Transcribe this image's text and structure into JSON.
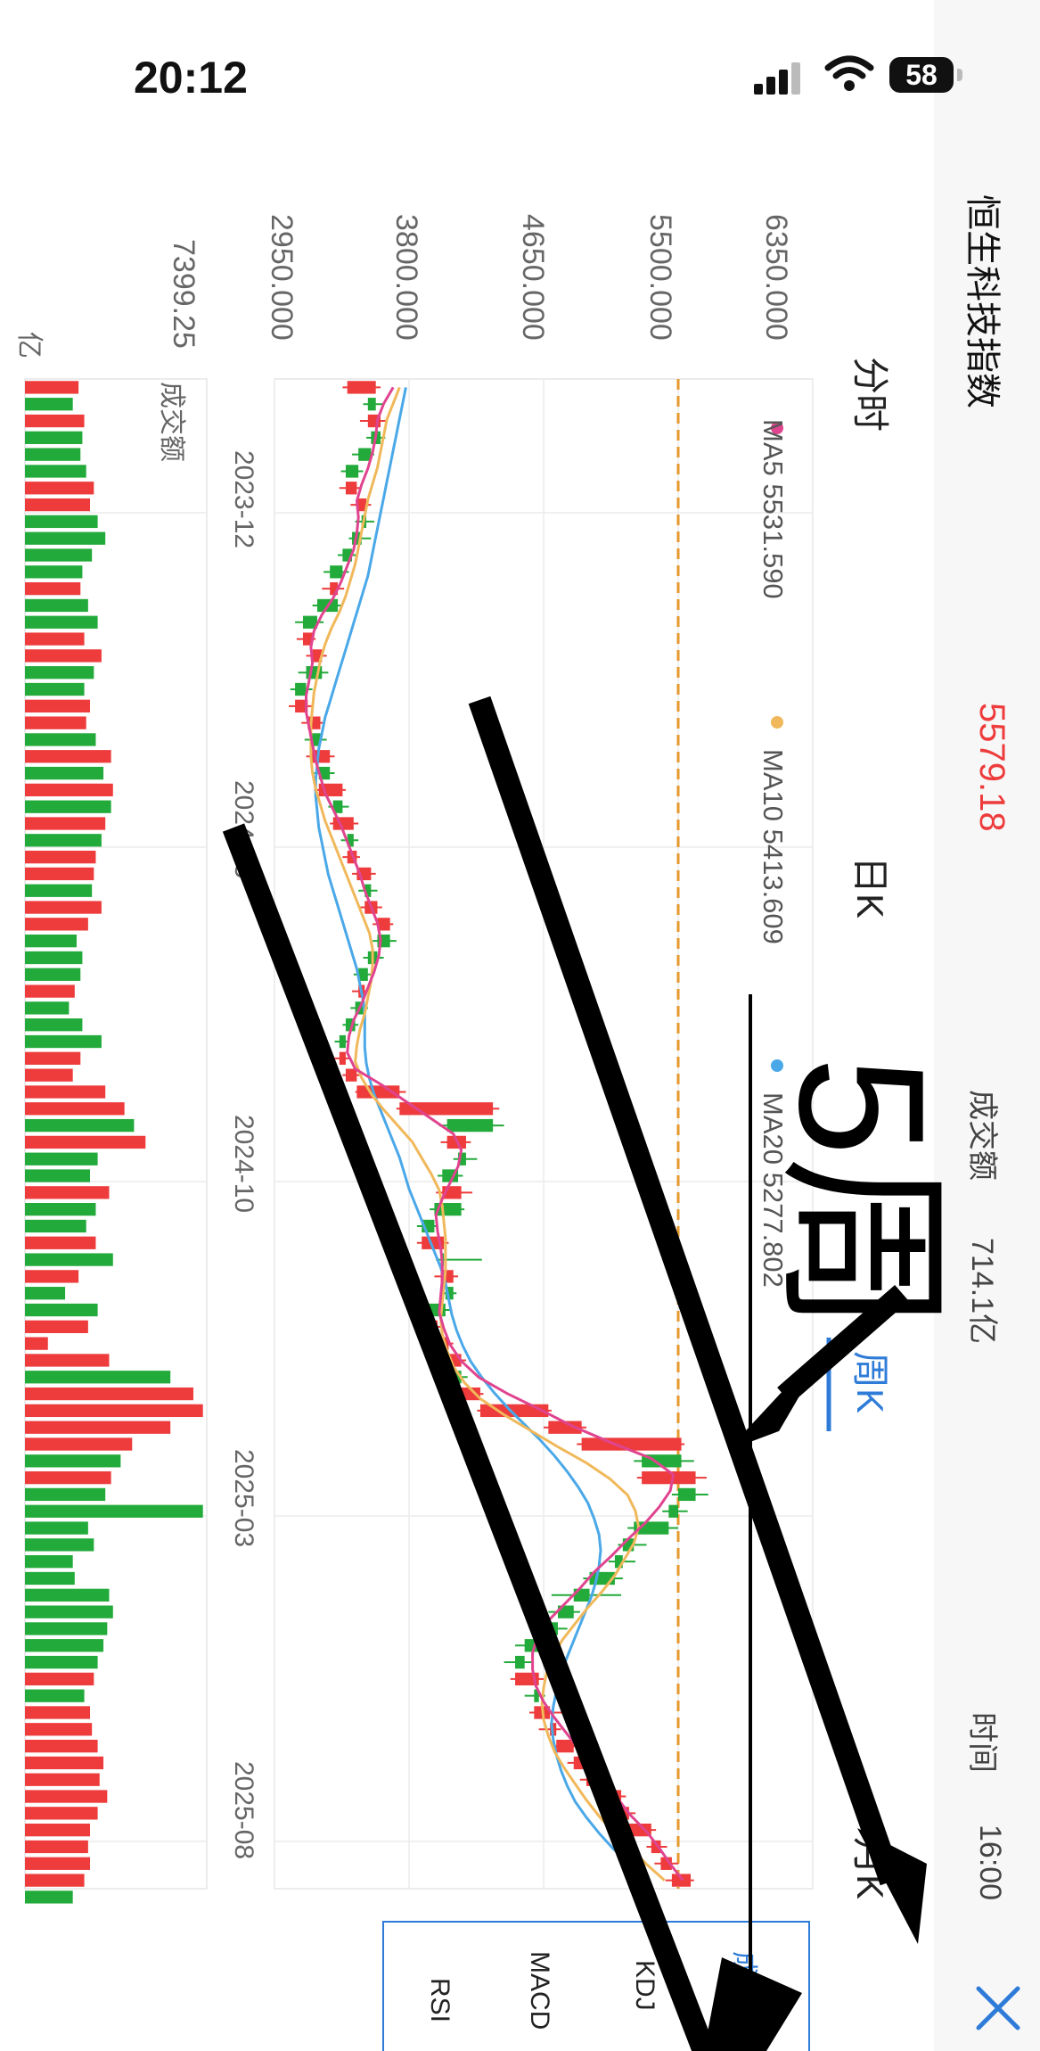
{
  "status_bar": {
    "time": "20:12",
    "battery": "58"
  },
  "header": {
    "title": "恒生科技指数",
    "price": "5579.18",
    "turnover_label": "成交额",
    "turnover_value": "714.1亿",
    "time_label": "时间",
    "time_value": "16:00",
    "close_icon": "close-icon"
  },
  "tabs": [
    {
      "label": "分时",
      "active": false
    },
    {
      "label": "日K",
      "active": false
    },
    {
      "label": "周K",
      "active": true
    },
    {
      "label": "月K",
      "active": false
    }
  ],
  "indicators": [
    {
      "label": "成交额",
      "active": true
    },
    {
      "label": "KDJ",
      "active": false
    },
    {
      "label": "MACD",
      "active": false
    },
    {
      "label": "RSI",
      "active": false
    }
  ],
  "volume_panel": {
    "label": "成交额",
    "max_label": "7399.25",
    "unit_label": "亿"
  },
  "annotation": {
    "text": "5周"
  },
  "colors": {
    "up": "#ee3b3b",
    "down": "#22aa3a",
    "ma5": "#e0448f",
    "ma10": "#f0b85a",
    "ma20": "#4aa8e8",
    "reference": "#e69a2e",
    "active_tab": "#2f7bd8"
  },
  "chart_data": {
    "type": "candlestick",
    "orientation": "rotated 90 degrees clockwise",
    "y_ticks": [
      "6350.000",
      "5500.000",
      "4650.000",
      "3800.000",
      "2950.000"
    ],
    "ylim": [
      2950,
      6350
    ],
    "x_ticks": [
      "2023-12",
      "2024-05",
      "2024-10",
      "2025-03",
      "2025-08"
    ],
    "legend": [
      {
        "name": "MA5",
        "value": "5531.590"
      },
      {
        "name": "MA10",
        "value": "5413.609"
      },
      {
        "name": "MA20",
        "value": "5277.802"
      }
    ],
    "reference_line": 5500,
    "weeks": [
      [
        3410,
        3590,
        3380,
        3620
      ],
      [
        3590,
        3540,
        3510,
        3640
      ],
      [
        3540,
        3620,
        3490,
        3660
      ],
      [
        3620,
        3560,
        3530,
        3650
      ],
      [
        3560,
        3480,
        3440,
        3580
      ],
      [
        3480,
        3400,
        3370,
        3510
      ],
      [
        3400,
        3470,
        3360,
        3490
      ],
      [
        3470,
        3530,
        3430,
        3560
      ],
      [
        3530,
        3500,
        3460,
        3580
      ],
      [
        3500,
        3440,
        3420,
        3560
      ],
      [
        3440,
        3380,
        3350,
        3470
      ],
      [
        3380,
        3300,
        3260,
        3420
      ],
      [
        3300,
        3350,
        3250,
        3390
      ],
      [
        3350,
        3220,
        3190,
        3380
      ],
      [
        3220,
        3130,
        3080,
        3260
      ],
      [
        3130,
        3190,
        3090,
        3210
      ],
      [
        3190,
        3250,
        3150,
        3280
      ],
      [
        3250,
        3150,
        3100,
        3290
      ],
      [
        3150,
        3080,
        3050,
        3190
      ],
      [
        3080,
        3160,
        3040,
        3190
      ],
      [
        3160,
        3240,
        3120,
        3270
      ],
      [
        3240,
        3180,
        3140,
        3280
      ],
      [
        3180,
        3300,
        3150,
        3330
      ],
      [
        3300,
        3230,
        3200,
        3330
      ],
      [
        3230,
        3380,
        3200,
        3400
      ],
      [
        3380,
        3320,
        3290,
        3420
      ],
      [
        3320,
        3450,
        3300,
        3480
      ],
      [
        3450,
        3410,
        3370,
        3480
      ],
      [
        3410,
        3470,
        3380,
        3490
      ],
      [
        3470,
        3560,
        3440,
        3590
      ],
      [
        3560,
        3520,
        3480,
        3600
      ],
      [
        3520,
        3600,
        3490,
        3630
      ],
      [
        3600,
        3680,
        3570,
        3700
      ],
      [
        3680,
        3600,
        3570,
        3720
      ],
      [
        3600,
        3540,
        3510,
        3640
      ],
      [
        3540,
        3480,
        3450,
        3560
      ],
      [
        3480,
        3520,
        3440,
        3550
      ],
      [
        3520,
        3460,
        3430,
        3540
      ],
      [
        3460,
        3400,
        3380,
        3480
      ],
      [
        3400,
        3360,
        3330,
        3420
      ],
      [
        3360,
        3400,
        3330,
        3430
      ],
      [
        3400,
        3470,
        3380,
        3490
      ],
      [
        3470,
        3740,
        3460,
        3780
      ],
      [
        3740,
        4330,
        3720,
        4370
      ],
      [
        4330,
        4040,
        3990,
        4400
      ],
      [
        4040,
        4160,
        4000,
        4190
      ],
      [
        4160,
        4110,
        4080,
        4230
      ],
      [
        4110,
        4010,
        3980,
        4140
      ],
      [
        4010,
        4130,
        3970,
        4200
      ],
      [
        4130,
        3960,
        3930,
        4150
      ],
      [
        3960,
        3880,
        3850,
        3980
      ],
      [
        3880,
        4020,
        3850,
        4050
      ],
      [
        4020,
        4000,
        3970,
        4260
      ],
      [
        4000,
        4080,
        3960,
        4110
      ],
      [
        4080,
        4030,
        4000,
        4100
      ],
      [
        4030,
        3900,
        3870,
        4060
      ],
      [
        3900,
        3980,
        3880,
        4010
      ],
      [
        3980,
        4050,
        3950,
        4080
      ],
      [
        4050,
        4130,
        4020,
        4160
      ],
      [
        4130,
        4090,
        4060,
        4170
      ],
      [
        4090,
        4250,
        4080,
        4270
      ],
      [
        4250,
        4680,
        4230,
        4700
      ],
      [
        4680,
        4890,
        4650,
        4920
      ],
      [
        4890,
        5520,
        4860,
        5540
      ],
      [
        5520,
        5270,
        5220,
        5600
      ],
      [
        5270,
        5610,
        5240,
        5680
      ],
      [
        5610,
        5500,
        5460,
        5690
      ],
      [
        5500,
        5440,
        5400,
        5560
      ],
      [
        5440,
        5220,
        5180,
        5500
      ],
      [
        5220,
        5150,
        5120,
        5300
      ],
      [
        5150,
        5100,
        5060,
        5230
      ],
      [
        5100,
        4940,
        4900,
        5150
      ],
      [
        4940,
        4840,
        4700,
        5140
      ],
      [
        4840,
        4740,
        4680,
        4880
      ],
      [
        4740,
        4650,
        4580,
        4800
      ],
      [
        4650,
        4530,
        4470,
        4690
      ],
      [
        4530,
        4470,
        4400,
        4580
      ],
      [
        4470,
        4620,
        4440,
        4650
      ],
      [
        4620,
        4590,
        4530,
        4660
      ],
      [
        4590,
        4690,
        4560,
        4860
      ],
      [
        4690,
        4730,
        4620,
        4760
      ],
      [
        4730,
        4840,
        4700,
        4860
      ],
      [
        4840,
        4920,
        4800,
        4950
      ],
      [
        4920,
        5030,
        4880,
        5060
      ],
      [
        5030,
        5140,
        4990,
        5170
      ],
      [
        5140,
        5190,
        5100,
        5230
      ],
      [
        5190,
        5330,
        5150,
        5360
      ],
      [
        5330,
        5390,
        5300,
        5430
      ],
      [
        5390,
        5460,
        5350,
        5500
      ],
      [
        5460,
        5579,
        5420,
        5600
      ]
    ],
    "volume": [
      2800,
      2500,
      3100,
      3000,
      2900,
      3200,
      3600,
      3400,
      3800,
      4200,
      3500,
      3000,
      2900,
      3300,
      3800,
      3100,
      4000,
      3600,
      3100,
      3400,
      3200,
      3700,
      4500,
      4100,
      4600,
      4500,
      4200,
      4000,
      3700,
      3600,
      3500,
      4000,
      3300,
      2700,
      3000,
      2900,
      2600,
      2300,
      3000,
      4000,
      2900,
      2500,
      4200,
      5200,
      5700,
      6300,
      3800,
      3400,
      4400,
      3700,
      3200,
      3700,
      4600,
      2800,
      2100,
      3800,
      3300,
      1200,
      4400,
      7600,
      8800,
      9300,
      7600,
      5600,
      5000,
      4500,
      4200,
      9300,
      3300,
      3600,
      2500,
      2600,
      4400,
      4600,
      4300,
      4100,
      3800,
      3600,
      3100,
      3400,
      3500,
      3800,
      4100,
      3900,
      4300,
      3800,
      3400,
      3300,
      3400,
      3100,
      2500
    ],
    "ma5": [
      3700,
      3640,
      3600,
      3590,
      3570,
      3540,
      3500,
      3470,
      3480,
      3470,
      3450,
      3410,
      3370,
      3320,
      3250,
      3200,
      3180,
      3190,
      3170,
      3150,
      3150,
      3170,
      3190,
      3210,
      3240,
      3270,
      3320,
      3370,
      3410,
      3450,
      3490,
      3520,
      3560,
      3600,
      3620,
      3610,
      3580,
      3540,
      3500,
      3450,
      3420,
      3410,
      3460,
      3630,
      3780,
      3930,
      4080,
      4130,
      4110,
      4060,
      4010,
      3970,
      3980,
      4000,
      4010,
      4010,
      4000,
      3990,
      4020,
      4060,
      4130,
      4240,
      4420,
      4630,
      4830,
      5070,
      5330,
      5470,
      5450,
      5380,
      5290,
      5180,
      5080,
      4970,
      4880,
      4780,
      4680,
      4610,
      4580,
      4580,
      4600,
      4650,
      4720,
      4800,
      4880,
      4960,
      5040,
      5120,
      5200,
      5300,
      5380,
      5450,
      5530
    ],
    "ma10": [
      3740,
      3700,
      3660,
      3640,
      3620,
      3600,
      3570,
      3540,
      3520,
      3500,
      3480,
      3460,
      3430,
      3400,
      3360,
      3310,
      3270,
      3240,
      3220,
      3200,
      3190,
      3180,
      3180,
      3180,
      3190,
      3210,
      3240,
      3270,
      3310,
      3350,
      3390,
      3430,
      3470,
      3510,
      3550,
      3570,
      3570,
      3560,
      3540,
      3520,
      3490,
      3470,
      3460,
      3500,
      3560,
      3640,
      3730,
      3820,
      3880,
      3940,
      3990,
      4010,
      4020,
      4030,
      4030,
      4030,
      4020,
      4010,
      4000,
      4010,
      4040,
      4080,
      4150,
      4250,
      4400,
      4570,
      4740,
      4920,
      5070,
      5180,
      5230,
      5250,
      5220,
      5160,
      5100,
      5020,
      4930,
      4850,
      4770,
      4710,
      4670,
      4650,
      4640,
      4650,
      4680,
      4720,
      4780,
      4850,
      4920,
      5000,
      5090,
      5200,
      5300,
      5414
    ],
    "ma20": [
      3780,
      3760,
      3740,
      3720,
      3700,
      3680,
      3660,
      3640,
      3620,
      3600,
      3580,
      3560,
      3540,
      3510,
      3480,
      3450,
      3420,
      3390,
      3360,
      3330,
      3300,
      3270,
      3250,
      3230,
      3220,
      3210,
      3210,
      3220,
      3230,
      3250,
      3270,
      3290,
      3320,
      3350,
      3380,
      3410,
      3440,
      3470,
      3490,
      3510,
      3520,
      3520,
      3520,
      3530,
      3550,
      3580,
      3620,
      3660,
      3700,
      3740,
      3770,
      3800,
      3840,
      3880,
      3920,
      3960,
      4000,
      4030,
      4050,
      4070,
      4100,
      4140,
      4190,
      4260,
      4340,
      4430,
      4530,
      4630,
      4720,
      4800,
      4870,
      4930,
      4970,
      5000,
      5010,
      5000,
      4980,
      4950,
      4910,
      4870,
      4830,
      4790,
      4760,
      4730,
      4710,
      4700,
      4710,
      4730,
      4760,
      4800,
      4850,
      4920,
      5000,
      5090,
      5200,
      5278
    ]
  }
}
